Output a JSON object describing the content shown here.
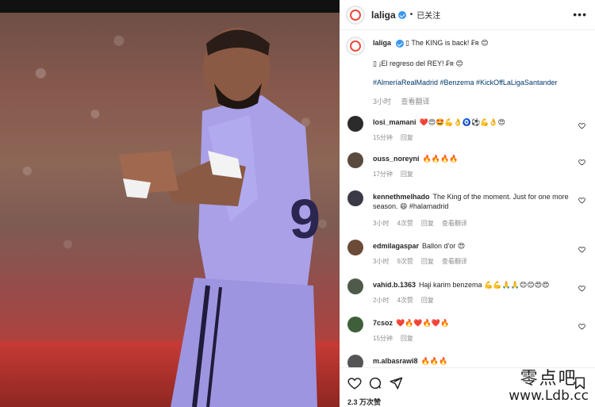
{
  "post": {
    "username": "laliga",
    "follow_state": "已关注",
    "separator": "•",
    "more_label": "•••"
  },
  "caption": {
    "username": "laliga",
    "line1": "▯ The KING is back! ₣ʀ 😊",
    "line2": "▯ ¡El regreso del REY! ₣ʀ 😊",
    "hashtags": "#AlmeríaRealMadrid #Benzema #KickOffLaLigaSantander",
    "time": "3小时",
    "translate": "查看翻译"
  },
  "comments": [
    {
      "user": "losi_mamani",
      "text": "❤️😍🤩💪👌🧿⚽💪👌😍",
      "time": "15分钟",
      "likes": "",
      "reply": "回复",
      "translate": "",
      "avatar_color": "#2b2b2b"
    },
    {
      "user": "ouss_noreyni",
      "text": "🔥🔥🔥🔥",
      "time": "17分钟",
      "likes": "",
      "reply": "回复",
      "translate": "",
      "avatar_color": "#5a4a3e"
    },
    {
      "user": "kennethmelhado",
      "text": "The King of the moment. Just for one more season. 😄 #halamadrid",
      "time": "3小时",
      "likes": "4次赞",
      "reply": "回复",
      "translate": "查看翻译",
      "avatar_color": "#3a3a46"
    },
    {
      "user": "edmilagaspar",
      "text": "Ballon d'or 😍",
      "time": "3小时",
      "likes": "9次赞",
      "reply": "回复",
      "translate": "查看翻译",
      "avatar_color": "#6b4b38"
    },
    {
      "user": "vahid.b.1363",
      "text": "Haji karim benzema 💪💪🙏🙏😊😊😍😍",
      "time": "2小时",
      "likes": "4次赞",
      "reply": "回复",
      "translate": "",
      "avatar_color": "#4f5a4a"
    },
    {
      "user": "7csoz",
      "text": "❤️🔥❤️🔥❤️🔥",
      "time": "15分钟",
      "likes": "",
      "reply": "回复",
      "translate": "",
      "avatar_color": "#3f5f3a"
    },
    {
      "user": "m.albasrawi8",
      "text": "🔥🔥🔥",
      "time": "",
      "likes": "",
      "reply": "",
      "translate": "",
      "avatar_color": "#555555"
    }
  ],
  "footer": {
    "likes": "2.3 万次赞"
  },
  "watermark": {
    "line1": "零点吧",
    "line2": "www.Ldb.cc"
  },
  "photo": {
    "jersey_number": "9"
  }
}
